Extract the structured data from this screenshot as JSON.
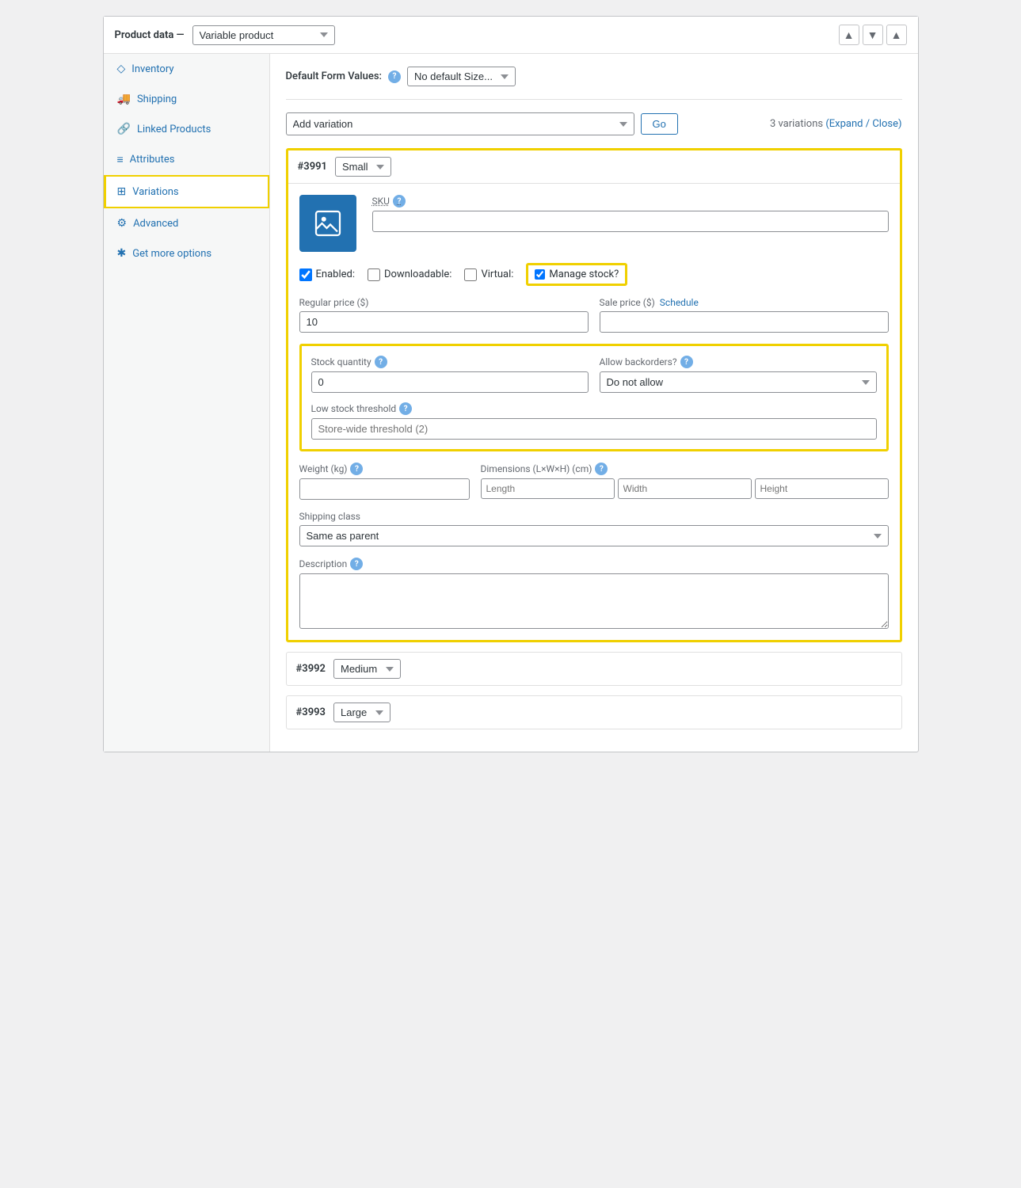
{
  "header": {
    "title": "Product data —",
    "product_type": "Variable product",
    "btn_up": "▲",
    "btn_down": "▼",
    "btn_expand": "▲"
  },
  "sidebar": {
    "items": [
      {
        "id": "inventory",
        "label": "Inventory",
        "icon": "◇"
      },
      {
        "id": "shipping",
        "label": "Shipping",
        "icon": "🚚"
      },
      {
        "id": "linked-products",
        "label": "Linked Products",
        "icon": "🔗"
      },
      {
        "id": "attributes",
        "label": "Attributes",
        "icon": "≡"
      },
      {
        "id": "variations",
        "label": "Variations",
        "icon": "⊞",
        "active": true
      },
      {
        "id": "advanced",
        "label": "Advanced",
        "icon": "⚙"
      },
      {
        "id": "get-more-options",
        "label": "Get more options",
        "icon": "✱"
      }
    ]
  },
  "main": {
    "default_form_label": "Default Form Values:",
    "default_form_value": "No default Size...",
    "add_variation_option": "Add variation",
    "go_button": "Go",
    "variations_count": "3 variations",
    "expand_close": "(Expand / Close)",
    "variation_3991": {
      "id": "#3991",
      "size": "Small",
      "sku_label": "SKU",
      "enabled_label": "Enabled:",
      "downloadable_label": "Downloadable:",
      "virtual_label": "Virtual:",
      "manage_stock_label": "Manage stock?",
      "enabled_checked": true,
      "downloadable_checked": false,
      "virtual_checked": false,
      "manage_stock_checked": true,
      "regular_price_label": "Regular price ($)",
      "regular_price_value": "10",
      "sale_price_label": "Sale price ($)",
      "schedule_label": "Schedule",
      "stock_qty_label": "Stock quantity",
      "stock_qty_value": "0",
      "backorders_label": "Allow backorders?",
      "backorders_value": "Do not allow",
      "low_stock_label": "Low stock threshold",
      "low_stock_placeholder": "Store-wide threshold (2)",
      "weight_label": "Weight (kg)",
      "dimensions_label": "Dimensions (L×W×H) (cm)",
      "length_placeholder": "Length",
      "width_placeholder": "Width",
      "height_placeholder": "Height",
      "shipping_class_label": "Shipping class",
      "shipping_class_value": "Same as parent",
      "description_label": "Description"
    },
    "variation_3992": {
      "id": "#3992",
      "size": "Medium"
    },
    "variation_3993": {
      "id": "#3993",
      "size": "Large"
    }
  }
}
